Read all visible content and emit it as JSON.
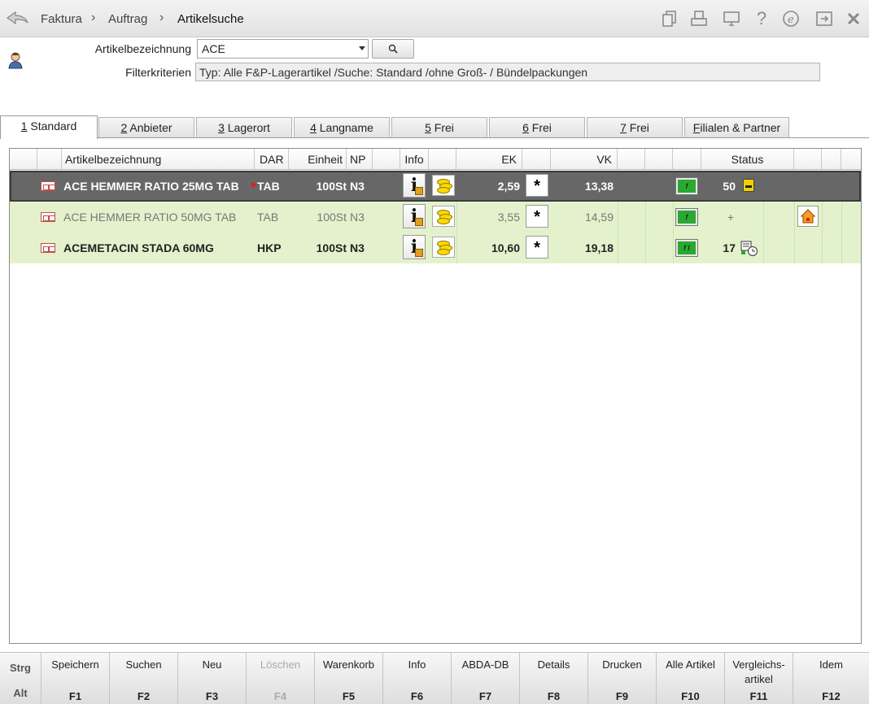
{
  "breadcrumb": [
    "Faktura",
    "Auftrag",
    "Artikelsuche"
  ],
  "search": {
    "label": "Artikelbezeichnung",
    "value": "ACE",
    "filter_label": "Filterkriterien",
    "filter_value": "Typ: Alle F&P-Lagerartikel /Suche: Standard /ohne Groß- / Bündelpackungen"
  },
  "tabs": [
    {
      "key": "1",
      "label": " Standard"
    },
    {
      "key": "2",
      "label": " Anbieter"
    },
    {
      "key": "3",
      "label": " Lagerort"
    },
    {
      "key": "4",
      "label": " Langname"
    },
    {
      "key": "5",
      "label": " Frei"
    },
    {
      "key": "6",
      "label": " Frei"
    },
    {
      "key": "7",
      "label": " Frei"
    },
    {
      "key": "F",
      "label": "ilialen & Partner"
    }
  ],
  "columns": {
    "artikel": "Artikelbezeichnung",
    "dar": "DAR",
    "einheit": "Einheit",
    "np": "NP",
    "info": "Info",
    "ek": "EK",
    "vk": "VK",
    "status": "Status"
  },
  "rows": [
    {
      "name": "ACE HEMMER RATIO 25MG TAB",
      "dar": "TAB",
      "einheit": "100St",
      "np": "N3",
      "ek": "2,59",
      "star": "*",
      "vk": "13,38",
      "status": "50"
    },
    {
      "name": "ACE HEMMER RATIO 50MG TAB",
      "dar": "TAB",
      "einheit": "100St",
      "np": "N3",
      "ek": "3,55",
      "star": "*",
      "vk": "14,59",
      "status": "+"
    },
    {
      "name": "ACEMETACIN STADA 60MG",
      "dar": "HKP",
      "einheit": "100St",
      "np": "N3",
      "ek": "10,60",
      "star": "*",
      "vk": "19,18",
      "status": "17"
    }
  ],
  "fkeys": {
    "mod_top": "Strg",
    "mod_bottom": "Alt",
    "items": [
      {
        "label": "Speichern",
        "code": "F1"
      },
      {
        "label": "Suchen",
        "code": "F2"
      },
      {
        "label": "Neu",
        "code": "F3"
      },
      {
        "label": "Löschen",
        "code": "F4"
      },
      {
        "label": "Warenkorb",
        "code": "F5"
      },
      {
        "label": "Info",
        "code": "F6"
      },
      {
        "label": "ABDA-DB",
        "code": "F7"
      },
      {
        "label": "Details",
        "code": "F8"
      },
      {
        "label": "Drucken",
        "code": "F9"
      },
      {
        "label": "Alle Artikel",
        "code": "F10"
      },
      {
        "label": "Vergleichs-",
        "label2": "artikel",
        "code": "F11"
      },
      {
        "label": "Idem",
        "code": "F12"
      }
    ]
  }
}
